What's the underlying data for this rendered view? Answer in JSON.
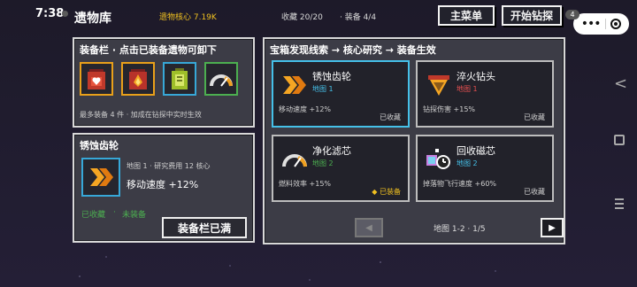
{
  "status_bar": {
    "time": "7:38"
  },
  "header": {
    "title": "遗物库",
    "core": "遗物核心 7.19K",
    "collected": "收藏 20/20",
    "equipped": "· 装备 4/4",
    "main_menu_label": "主菜单",
    "start_label": "开始钻探",
    "capsule_badge": "4"
  },
  "equipment_panel": {
    "title": "装备栏 · 点击已装备遗物可卸下",
    "slots": [
      {
        "name": "red-heart-backpack",
        "color": "#e9a01a"
      },
      {
        "name": "red-fire-backpack",
        "color": "#e9a01a"
      },
      {
        "name": "green-battery-pack",
        "color": "#37a8d8"
      },
      {
        "name": "speed-gauge",
        "color": "#4caf50"
      }
    ],
    "note": "最多装备 4 件 · 加成在钻探中实时生效"
  },
  "detail_panel": {
    "title": "锈蚀齿轮",
    "meta": "地图 1 · 研究费用 12 核心",
    "effect": "移动速度 +12%",
    "status_collected": "已收藏",
    "status_sep": "·",
    "status_unequipped": "未装备",
    "action_label": "装备栏已满"
  },
  "research_panel": {
    "title": "宝箱发现线索 → 核心研究 → 装备生效",
    "cards": [
      {
        "name": "锈蚀齿轮",
        "map": "地图 1",
        "map_color": "#45c0e8",
        "stat": "移动速度 +12%",
        "status": "已收藏",
        "icon": "chevron-gear-icon"
      },
      {
        "name": "淬火钻头",
        "map": "地图 1",
        "map_color": "#e85050",
        "stat": "钻探伤害 +15%",
        "status": "已收藏",
        "icon": "drill-icon"
      },
      {
        "name": "净化滤芯",
        "map": "地图 2",
        "map_color": "#4caf50",
        "stat": "燃料效率 +15%",
        "status": "◆ 已装备",
        "icon": "gauge-icon"
      },
      {
        "name": "回收磁芯",
        "map": "地图 2",
        "map_color": "#45c0e8",
        "stat": "掉落物飞行速度 +60%",
        "status": "已收藏",
        "icon": "magnet-core-icon"
      }
    ],
    "pagination": {
      "prev": "◀",
      "next": "▶",
      "info": "地图 1-2 · 1/5"
    }
  }
}
